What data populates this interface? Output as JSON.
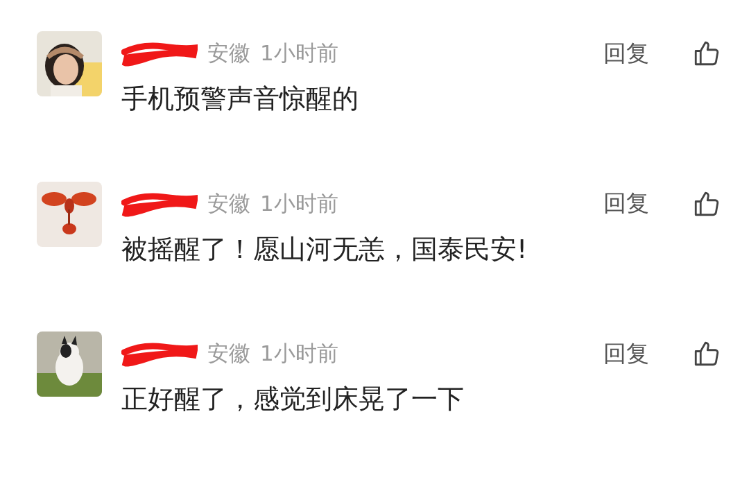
{
  "comments": [
    {
      "name_redacted": true,
      "location": "安徽",
      "time": "1小时前",
      "reply": "回复",
      "text": "手机预警声音惊醒的"
    },
    {
      "name_redacted": true,
      "location": "安徽",
      "time": "1小时前",
      "reply": "回复",
      "text": "被摇醒了！愿山河无恙，国泰民安!"
    },
    {
      "name_redacted": true,
      "location": "安徽",
      "time": "1小时前",
      "reply": "回复",
      "text": "正好醒了，感觉到床晃了一下"
    }
  ]
}
